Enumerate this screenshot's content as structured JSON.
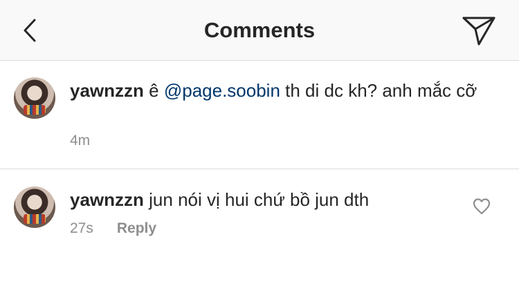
{
  "header": {
    "title": "Comments",
    "back_icon": "chevron-left-icon",
    "share_icon": "paper-plane-icon"
  },
  "comments": [
    {
      "username": "yawnzzn",
      "text_before": " ê ",
      "mention": "@page.soobin",
      "text_after": " th di dc kh? anh mắc cỡ",
      "time": "4m"
    },
    {
      "username": "yawnzzn",
      "text": " jun nói vị hui chứ bồ jun dth",
      "time": "27s",
      "reply_label": "Reply",
      "like_icon": "heart-icon"
    }
  ],
  "colors": {
    "mention": "#00376b",
    "meta": "#8e8e8e",
    "divider": "#dbdbdb",
    "header_bg": "#f9f9f9"
  }
}
